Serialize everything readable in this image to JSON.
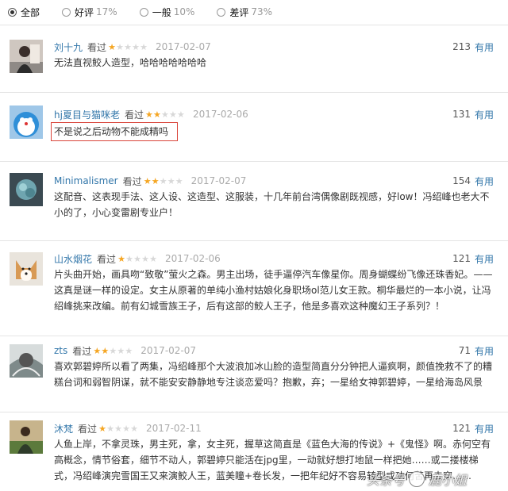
{
  "filters": [
    {
      "label": "全部",
      "pct": "",
      "checked": true
    },
    {
      "label": "好评",
      "pct": "17%",
      "checked": false
    },
    {
      "label": "一般",
      "pct": "10%",
      "checked": false
    },
    {
      "label": "差评",
      "pct": "73%",
      "checked": false
    }
  ],
  "watched_label": "看过",
  "useful_label": "有用",
  "reviews": [
    {
      "user": "刘十九",
      "rating": 1,
      "date": "2017-02-07",
      "votes": "213",
      "text": "无法直视鲛人造型，哈哈哈哈哈哈哈"
    },
    {
      "user": "hj夏目与猫咪老",
      "rating": 2,
      "date": "2017-02-06",
      "votes": "131",
      "text": "不是说之后动物不能成精吗"
    },
    {
      "user": "Minimalismer",
      "rating": 2,
      "date": "2017-02-07",
      "votes": "154",
      "text": "这配音、这表现手法、这人设、这造型、这服装，十几年前台湾偶像剧既视感，好low！冯绍峰也老大不小的了，小心变雷剧专业户！"
    },
    {
      "user": "山水烟花",
      "rating": 1,
      "date": "2017-02-06",
      "votes": "121",
      "text": "片头曲开始，画具吻“致敬”萤火之森。男主出场，徒手逼停汽车像星你。周身蝴蝶纷飞像还珠香妃。——这真是谜一样的设定。女主从原著的单纯小渔村姑娘化身职场ol范儿女王款。桐华最烂的一本小说，让冯绍峰挑来改编。前有幻城雪族王子，后有这部的鲛人王子，他是多喜欢这种魔幻王子系列？！"
    },
    {
      "user": "zts",
      "rating": 2,
      "date": "2017-02-07",
      "votes": "71",
      "text": "喜欢郭碧婷所以看了两集，冯绍峰那个大波浪加冰山脸的造型简直分分钟把人逼疯啊，颜值挽救不了的糟糕台词和弱智阴谋，就不能安安静静地专注谈恋爱吗？抱歉，弃；一星给女神郭碧婷，一星给海岛风景"
    },
    {
      "user": "沐梵",
      "rating": 1,
      "date": "2017-02-11",
      "votes": "121",
      "text": "人鱼上岸，不拿灵珠，男主死，拿，女主死，握草这简直是《蓝色大海的传说》+《鬼怪》啊。赤何空有高概念，情节俗套，细节不动人，郭碧婷只能活在jpg里，一动就好想打地鼠一样把她……或二搂楼梯式，冯绍峰演完雪国王又来演鲛人王，蓝美瞳+卷长发，一把年纪好不容易转型成功何苦再去穿……"
    }
  ],
  "watermark": {
    "left": "头条号",
    "right": "鹿小姐"
  }
}
